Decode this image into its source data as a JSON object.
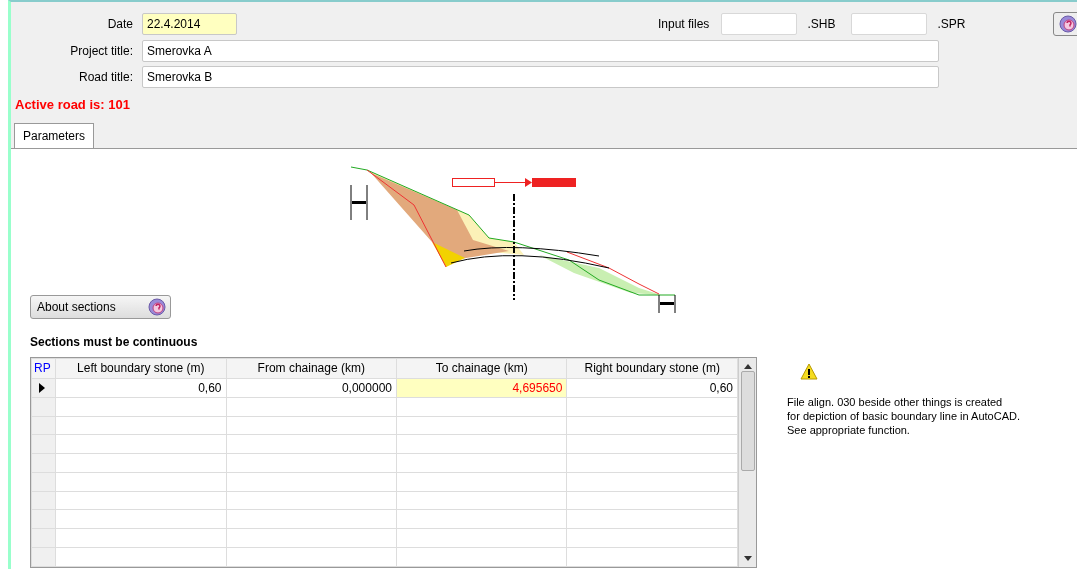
{
  "header": {
    "date": {
      "label": "Date",
      "value": "22.4.2014"
    },
    "input_files": {
      "label": "Input files",
      "suffixes": [
        ".SHB",
        ".SPR"
      ]
    },
    "project_title": {
      "label": "Project title:",
      "value": "Smerovka A"
    },
    "road_title": {
      "label": "Road title:",
      "value": "Smerovka B"
    },
    "active_road": "Active road is: 101"
  },
  "tabs": [
    {
      "label": "Parameters",
      "selected": true
    }
  ],
  "about_button": "About sections",
  "sections": {
    "title": "Sections must be continuous",
    "corner_label": "RP",
    "columns": [
      "Left boundary stone (m)",
      "From chainage (km)",
      "To chainage (km)",
      "Right boundary stone (m)"
    ],
    "rows": [
      {
        "selected": true,
        "cells": [
          {
            "text": "0,60",
            "highlighted": false
          },
          {
            "text": "0,000000",
            "highlighted": false
          },
          {
            "text": "4,695650",
            "highlighted": true
          },
          {
            "text": "0,60",
            "highlighted": false
          }
        ]
      }
    ]
  },
  "notice": "File align. 030 beside other things is created\nfor depiction of basic boundary line in AutoCAD.\nSee appropriate function."
}
